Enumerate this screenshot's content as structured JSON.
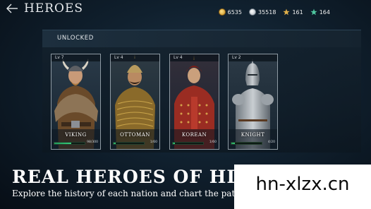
{
  "header": {
    "title": "HEROES",
    "back_icon": "back-arrow-icon"
  },
  "resources": [
    {
      "icon": "gold-coin-icon",
      "value": "6535"
    },
    {
      "icon": "silver-coin-icon",
      "value": "35518"
    },
    {
      "icon": "gold-star-icon",
      "value": "161"
    },
    {
      "icon": "green-star-icon",
      "value": "164"
    }
  ],
  "panel": {
    "title": "UNLOCKED"
  },
  "heroes": [
    {
      "name": "VIKING",
      "level": "Lv 7",
      "progress": 0.56,
      "xp": "98/300"
    },
    {
      "name": "OTTOMAN",
      "level": "Lv 4",
      "progress": 0.08,
      "xp": "1/60"
    },
    {
      "name": "KOREAN",
      "level": "Lv 4",
      "progress": 0.08,
      "xp": "1/60"
    },
    {
      "name": "KNIGHT",
      "level": "Lv 2",
      "progress": 0.12,
      "xp": "4/20"
    }
  ],
  "promo": {
    "headline": "REAL HEROES OF HIST",
    "subline": "Explore the history of each nation and chart the path o"
  },
  "watermark": {
    "text": "hn-xlzx.cn"
  },
  "colors": {
    "accent_green": "#38c878",
    "gold": "#e0b04a",
    "frame": "#8e9aa3"
  }
}
